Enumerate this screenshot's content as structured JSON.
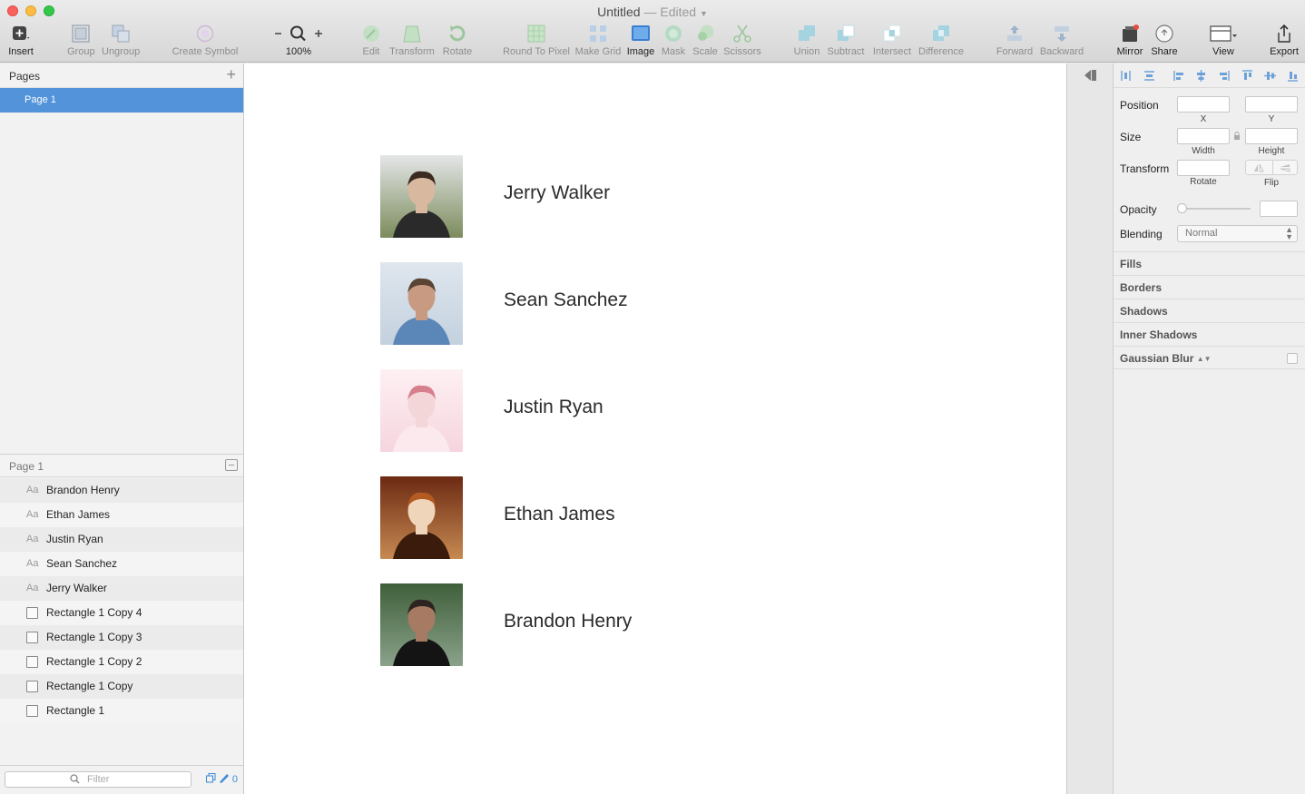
{
  "window": {
    "title": "Untitled",
    "edited": "— Edited"
  },
  "toolbar": {
    "insert": "Insert",
    "group": "Group",
    "ungroup": "Ungroup",
    "create_symbol": "Create Symbol",
    "zoom": "100%",
    "edit": "Edit",
    "transform": "Transform",
    "rotate": "Rotate",
    "round_to_pixel": "Round To Pixel",
    "make_grid": "Make Grid",
    "image": "Image",
    "mask": "Mask",
    "scale": "Scale",
    "scissors": "Scissors",
    "union": "Union",
    "subtract": "Subtract",
    "intersect": "Intersect",
    "difference": "Difference",
    "forward": "Forward",
    "backward": "Backward",
    "mirror": "Mirror",
    "share": "Share",
    "view": "View",
    "export": "Export"
  },
  "pages_panel": {
    "title": "Pages",
    "pages": [
      "Page 1"
    ],
    "layers_title": "Page 1",
    "layers": [
      {
        "type": "text",
        "name": "Brandon Henry"
      },
      {
        "type": "text",
        "name": "Ethan James"
      },
      {
        "type": "text",
        "name": "Justin Ryan"
      },
      {
        "type": "text",
        "name": "Sean Sanchez"
      },
      {
        "type": "text",
        "name": "Jerry Walker"
      },
      {
        "type": "rect",
        "name": "Rectangle 1 Copy 4"
      },
      {
        "type": "rect",
        "name": "Rectangle 1 Copy 3"
      },
      {
        "type": "rect",
        "name": "Rectangle 1 Copy 2"
      },
      {
        "type": "rect",
        "name": "Rectangle 1 Copy"
      },
      {
        "type": "rect",
        "name": "Rectangle 1"
      }
    ],
    "text_layer_icon": "Aa",
    "filter_placeholder": "Filter",
    "filter_count": "0"
  },
  "canvas": {
    "people": [
      {
        "name": "Jerry Walker"
      },
      {
        "name": "Sean Sanchez"
      },
      {
        "name": "Justin Ryan"
      },
      {
        "name": "Ethan James"
      },
      {
        "name": "Brandon Henry"
      }
    ]
  },
  "inspector": {
    "position": "Position",
    "x": "X",
    "y": "Y",
    "size": "Size",
    "width": "Width",
    "height": "Height",
    "transform": "Transform",
    "rotate": "Rotate",
    "flip": "Flip",
    "opacity": "Opacity",
    "blending": "Blending",
    "blending_value": "Normal",
    "fills": "Fills",
    "borders": "Borders",
    "shadows": "Shadows",
    "inner_shadows": "Inner Shadows",
    "gaussian_blur": "Gaussian Blur"
  },
  "colors": {
    "selection": "#5293d9",
    "accent": "#3b8ad8"
  }
}
